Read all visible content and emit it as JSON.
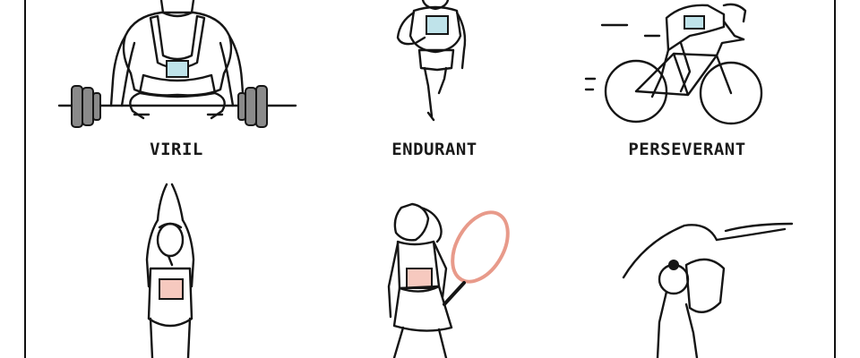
{
  "panels": [
    {
      "caption": "VIRIL"
    },
    {
      "caption": "ENDURANT"
    },
    {
      "caption": "PERSEVERANT"
    }
  ],
  "colors": {
    "ink": "#151515",
    "bib_blue": "#bfe3ea",
    "bib_pink": "#f6c9bf",
    "suit_gray": "#cfcfcf",
    "weight_gray": "#8a8a8a",
    "racket_pink": "#e89a8a"
  },
  "icons": [
    "weightlifter-figure",
    "runner-figure",
    "cyclist-figure",
    "swimmer-diver-figure",
    "tennis-player-figure",
    "gymnast-figure"
  ]
}
